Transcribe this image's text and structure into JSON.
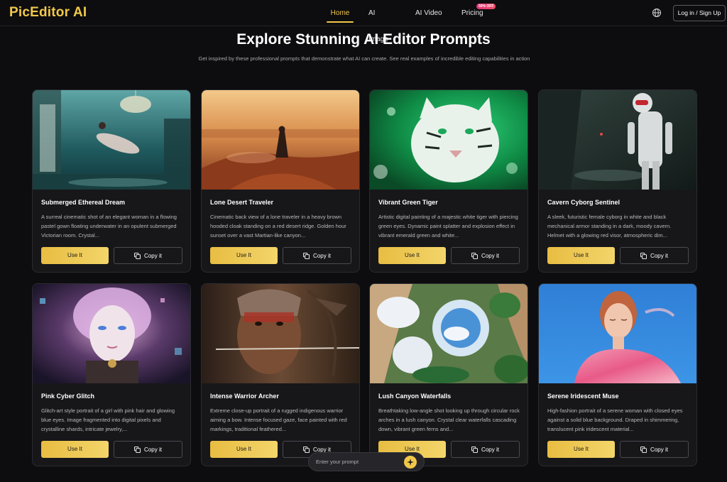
{
  "header": {
    "logo": "PicEditor AI",
    "nav": [
      {
        "label": "Home",
        "active": true
      },
      {
        "label": "AI Image"
      },
      {
        "label": "AI Video"
      },
      {
        "label": "Pricing"
      }
    ],
    "pricing_badge": "50% OFF",
    "login_label": "Log in / Sign Up",
    "icons": {
      "language": "globe-icon"
    }
  },
  "hero": {
    "title": "Explore Stunning AI Editor Prompts",
    "subtitle": "Get inspired by these professional prompts that demonstrate what AI can create. See real examples of incredible editing capabilities in action"
  },
  "cards": [
    {
      "title": "Submerged Ethereal Dream",
      "description": "A surreal cinematic shot of an elegant woman in a flowing pastel gown floating underwater in an opulent submerged Victorian room. Crystal...",
      "use_label": "Use It",
      "copy_label": "Copy it"
    },
    {
      "title": "Lone Desert Traveler",
      "description": "Cinematic back view of a lone traveler in a heavy brown hooded cloak standing on a red desert ridge. Golden hour sunset over a vast Martian-like canyon...",
      "use_label": "Use It",
      "copy_label": "Copy it"
    },
    {
      "title": "Vibrant Green Tiger",
      "description": "Artistic digital painting of a majestic white tiger with piercing green eyes. Dynamic paint splatter and explosion effect in vibrant emerald green and white...",
      "use_label": "Use It",
      "copy_label": "Copy it"
    },
    {
      "title": "Cavern Cyborg Sentinel",
      "description": "A sleek, futuristic female cyborg in white and black mechanical armor standing in a dark, moody cavern. Helmet with a glowing red visor, atmospheric dim...",
      "use_label": "Use It",
      "copy_label": "Copy it"
    },
    {
      "title": "Pink Cyber Glitch",
      "description": "Glitch-art style portrait of a girl with pink hair and glowing blue eyes. Image fragmented into digital pixels and crystalline shards, intricate jewelry,...",
      "use_label": "Use It",
      "copy_label": "Copy it"
    },
    {
      "title": "Intense Warrior Archer",
      "description": "Extreme close-up portrait of a rugged indigenous warrior aiming a bow. Intense focused gaze, face painted with red markings, traditional feathered...",
      "use_label": "Use It",
      "copy_label": "Copy it"
    },
    {
      "title": "Lush Canyon Waterfalls",
      "description": "Breathtaking low-angle shot looking up through circular rock arches in a lush canyon. Crystal clear waterfalls cascading down, vibrant green ferns and...",
      "use_label": "Use It",
      "copy_label": "Copy it"
    },
    {
      "title": "Serene Iridescent Muse",
      "description": "High-fashion portrait of a serene woman with closed eyes against a solid blue background. Draped in shimmering, translucent pink iridescent material...",
      "use_label": "Use It",
      "copy_label": "Copy it"
    }
  ],
  "prompt": {
    "placeholder": "Enter your prompt",
    "icon": "sparkle-icon"
  },
  "colors": {
    "accent": "#f1c84a",
    "background": "#0d0d0f",
    "card": "#17171a"
  }
}
